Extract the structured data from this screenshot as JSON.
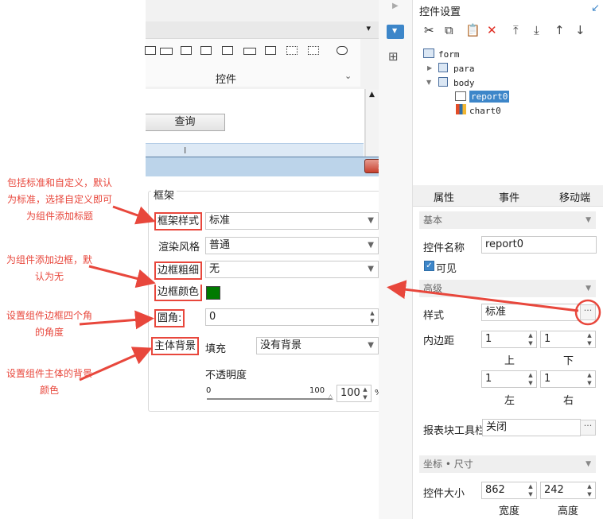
{
  "annotations": [
    "包括标准和自定义，默认为标准，选择自定义即可为组件添加标题",
    "为组件添加边框，默认为无",
    "设置组件边框四个角的角度",
    "设置组件主体的背景颜色"
  ],
  "designer": {
    "widget_section_label": "控件",
    "query_button_label": "查询",
    "cursor_glyph": "I"
  },
  "dialog": {
    "close_label": "x",
    "group_title": "框架",
    "frame_style": {
      "label": "框架样式",
      "value": "标准"
    },
    "render_style": {
      "label": "渲染风格",
      "value": "普通"
    },
    "border_width": {
      "label": "边框粗细",
      "value": "无"
    },
    "border_color": {
      "label": "边框颜色",
      "color": "#007a00"
    },
    "corner_radius": {
      "label": "圆角:",
      "value": "0"
    },
    "body_background": {
      "label": "主体背景",
      "fill_label": "填充",
      "value": "没有背景"
    },
    "opacity": {
      "label": "不透明度",
      "min": "0",
      "max": "100",
      "value": "100",
      "unit": "%",
      "level": 1.0
    }
  },
  "panel": {
    "title": "控件设置",
    "tree": {
      "form": "form",
      "para": "para",
      "body": "body",
      "report": "report0",
      "chart": "chart0"
    },
    "tabs": {
      "attributes": "属性",
      "events": "事件",
      "mobile": "移动端"
    },
    "basic": {
      "section": "基本",
      "name_label": "控件名称",
      "name_value": "report0",
      "visible_label": "可见"
    },
    "advanced": {
      "section": "高级",
      "style_label": "样式",
      "style_value": "标准",
      "padding_label": "内边距",
      "padding_top": "1",
      "padding_bottom": "1",
      "padding_left": "1",
      "padding_right": "1",
      "top_label": "上",
      "bottom_label": "下",
      "left_label": "左",
      "right_label": "右",
      "toolbar_label": "报表块工具栏",
      "toolbar_value": "关闭"
    },
    "size": {
      "section": "坐标 • 尺寸",
      "size_label": "控件大小",
      "width": "862",
      "height": "242",
      "width_label": "宽度",
      "height_label": "高度"
    }
  },
  "colors": {
    "accent": "#e8473c",
    "selection": "#3d86c9"
  }
}
